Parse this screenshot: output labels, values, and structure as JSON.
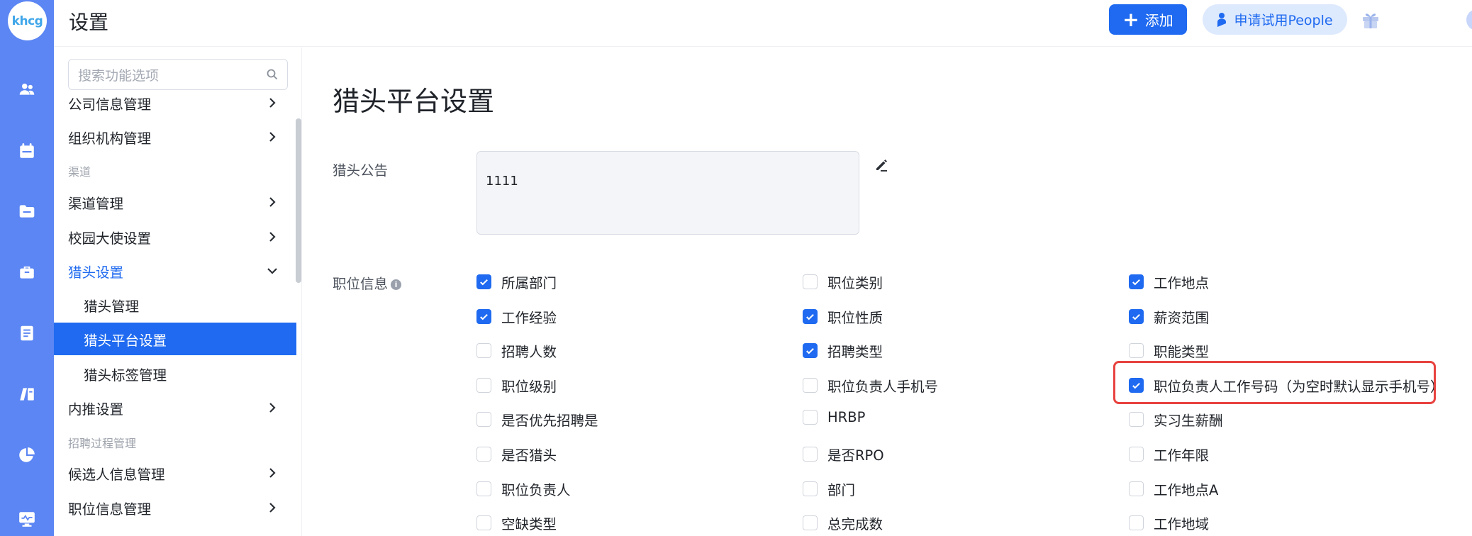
{
  "app": {
    "logo": "khcg",
    "page_title": "设置"
  },
  "topbar": {
    "add_label": "添加",
    "trial_label": "申请试用People",
    "help_label": "?"
  },
  "rail": {
    "icons": [
      "people-icon",
      "calendar-icon",
      "folder-icon",
      "briefcase-icon",
      "document-icon",
      "books-icon",
      "pie-chart-icon",
      "monitor-icon"
    ]
  },
  "sidebar": {
    "search_placeholder": "搜索功能选项",
    "items": {
      "company_info": "公司信息管理",
      "org": "组织机构管理",
      "group_channel": "渠道",
      "channel_mgmt": "渠道管理",
      "campus": "校园大使设置",
      "headhunter_settings": "猎头设置",
      "headhunter_mgmt": "猎头管理",
      "headhunter_platform": "猎头平台设置",
      "headhunter_tags": "猎头标签管理",
      "referral": "内推设置",
      "group_process": "招聘过程管理",
      "candidate_info": "候选人信息管理",
      "job_info": "职位信息管理"
    }
  },
  "main": {
    "title": "猎头平台设置",
    "notice_label": "猎头公告",
    "notice_value": "1111",
    "job_info_label": "职位信息",
    "checkboxes": [
      {
        "label": "所属部门",
        "checked": true
      },
      {
        "label": "职位类别",
        "checked": false
      },
      {
        "label": "工作地点",
        "checked": true
      },
      {
        "label": "工作经验",
        "checked": true
      },
      {
        "label": "职位性质",
        "checked": true
      },
      {
        "label": "薪资范围",
        "checked": true
      },
      {
        "label": "招聘人数",
        "checked": false
      },
      {
        "label": "招聘类型",
        "checked": true
      },
      {
        "label": "职能类型",
        "checked": false
      },
      {
        "label": "职位级别",
        "checked": false
      },
      {
        "label": "职位负责人手机号",
        "checked": false
      },
      {
        "label": "职位负责人工作号码（为空时默认显示手机号）",
        "checked": true
      },
      {
        "label": "是否优先招聘是",
        "checked": false
      },
      {
        "label": "HRBP",
        "checked": false
      },
      {
        "label": "实习生薪酬",
        "checked": false
      },
      {
        "label": "是否猎头",
        "checked": false
      },
      {
        "label": "是否RPO",
        "checked": false
      },
      {
        "label": "工作年限",
        "checked": false
      },
      {
        "label": "职位负责人",
        "checked": false
      },
      {
        "label": "部门",
        "checked": false
      },
      {
        "label": "工作地点A",
        "checked": false
      },
      {
        "label": "空缺类型",
        "checked": false
      },
      {
        "label": "总完成数",
        "checked": false
      },
      {
        "label": "工作地域",
        "checked": false
      }
    ]
  },
  "colors": {
    "accent": "#1f6af0",
    "rail": "#5b86f3",
    "highlight": "#e8423f"
  }
}
